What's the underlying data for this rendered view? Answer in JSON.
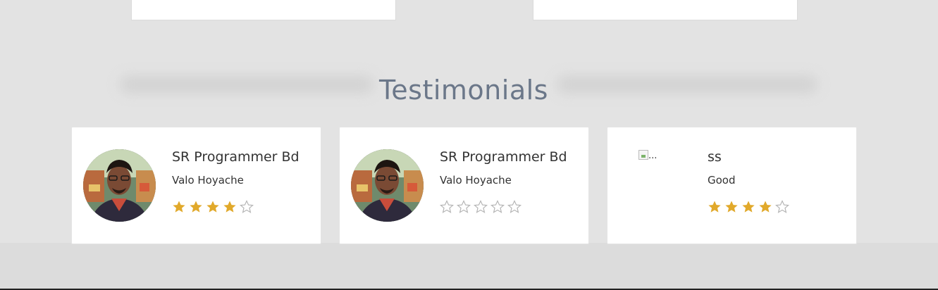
{
  "section": {
    "title": "Testimonials"
  },
  "colors": {
    "star_filled": "#e1a92b",
    "star_empty": "#b5b5b5",
    "title": "#6b7789"
  },
  "testimonials": [
    {
      "name": "SR Programmer Bd",
      "text": "Valo Hoyache",
      "rating": 4,
      "max_rating": 5,
      "image": "avatar-photo"
    },
    {
      "name": "SR Programmer Bd",
      "text": "Valo Hoyache",
      "rating": 0,
      "max_rating": 5,
      "image": "avatar-photo"
    },
    {
      "name": "ss",
      "text": "Good",
      "rating": 4,
      "max_rating": 5,
      "image": "broken-image",
      "image_alt": "..."
    }
  ]
}
